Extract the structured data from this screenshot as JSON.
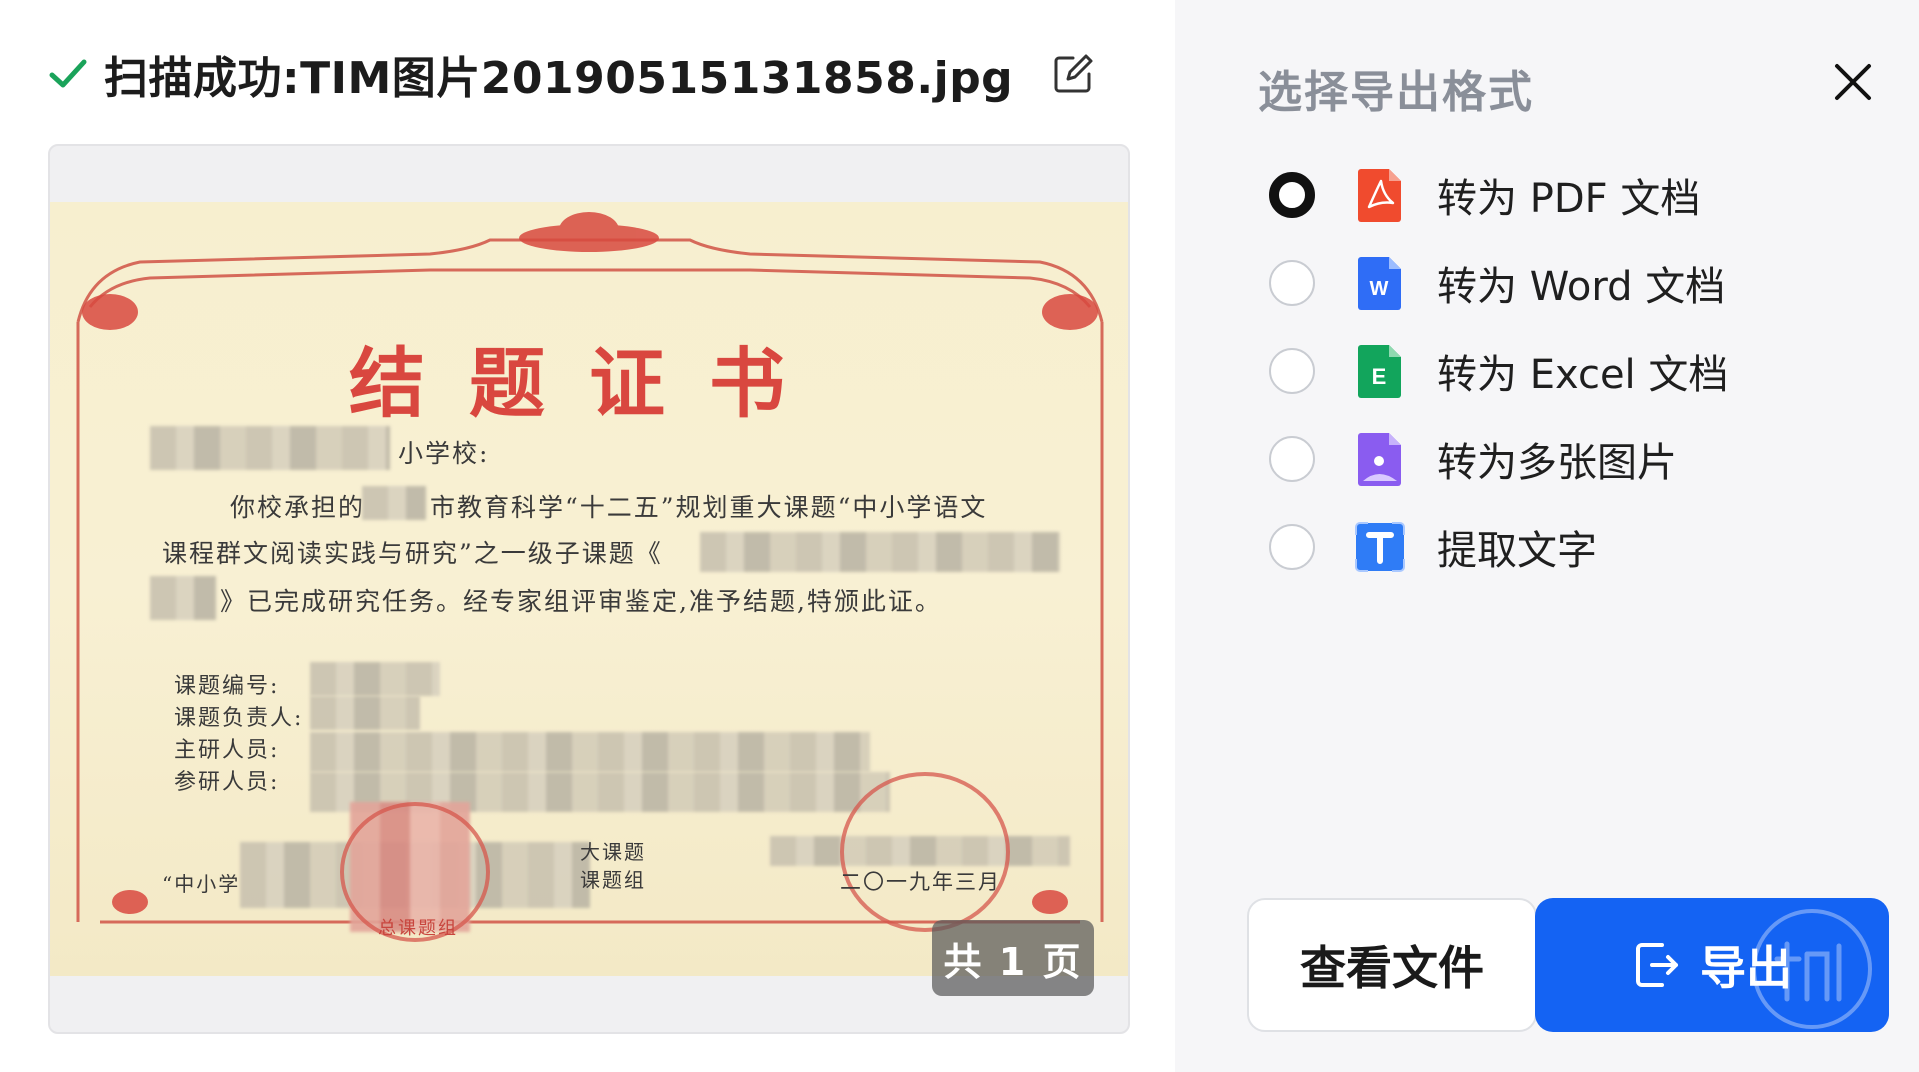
{
  "scan": {
    "status_label": "扫描成功",
    "separator": ":",
    "filename": "TIM图片20190515131858.jpg",
    "page_count_label": "共 1 页"
  },
  "certificate": {
    "title": "结题证书",
    "addressee_suffix": "小学校:",
    "line1_a": "你校承担的",
    "line1_b": "市教育科学“十二五”规划重大课题“中小学语文",
    "line2": "课程群文阅读实践与研究”之一级子课题《",
    "line3": "》已完成研究任务。经专家组评审鉴定,准予结题,特颁此证。",
    "field_number": "课题编号:",
    "field_leader": "课题负责人:",
    "field_main": "主研人员:",
    "field_members": "参研人员:",
    "sign_prefix": "“中小学",
    "sign_group_a": "大课题",
    "sign_group_b": "课题组",
    "date": "二〇一九年三月",
    "seal_text": "总课题组"
  },
  "panel": {
    "title": "选择导出格式",
    "options": [
      {
        "label": "转为 PDF 文档",
        "icon": "pdf-icon",
        "selected": true,
        "color": "#f04b2e"
      },
      {
        "label": "转为 Word 文档",
        "icon": "word-icon",
        "selected": false,
        "color": "#2f6df6"
      },
      {
        "label": "转为 Excel 文档",
        "icon": "excel-icon",
        "selected": false,
        "color": "#12a55c"
      },
      {
        "label": "转为多张图片",
        "icon": "image-icon",
        "selected": false,
        "color": "#8a5cf0"
      },
      {
        "label": "提取文字",
        "icon": "text-icon",
        "selected": false,
        "color": "#2f7cf6"
      }
    ],
    "view_button": "查看文件",
    "export_button": "导出"
  },
  "colors": {
    "accent": "#1463f3",
    "success": "#1aa35a",
    "certificate_red": "#d9473f",
    "panel_bg": "#f6f6f8"
  }
}
